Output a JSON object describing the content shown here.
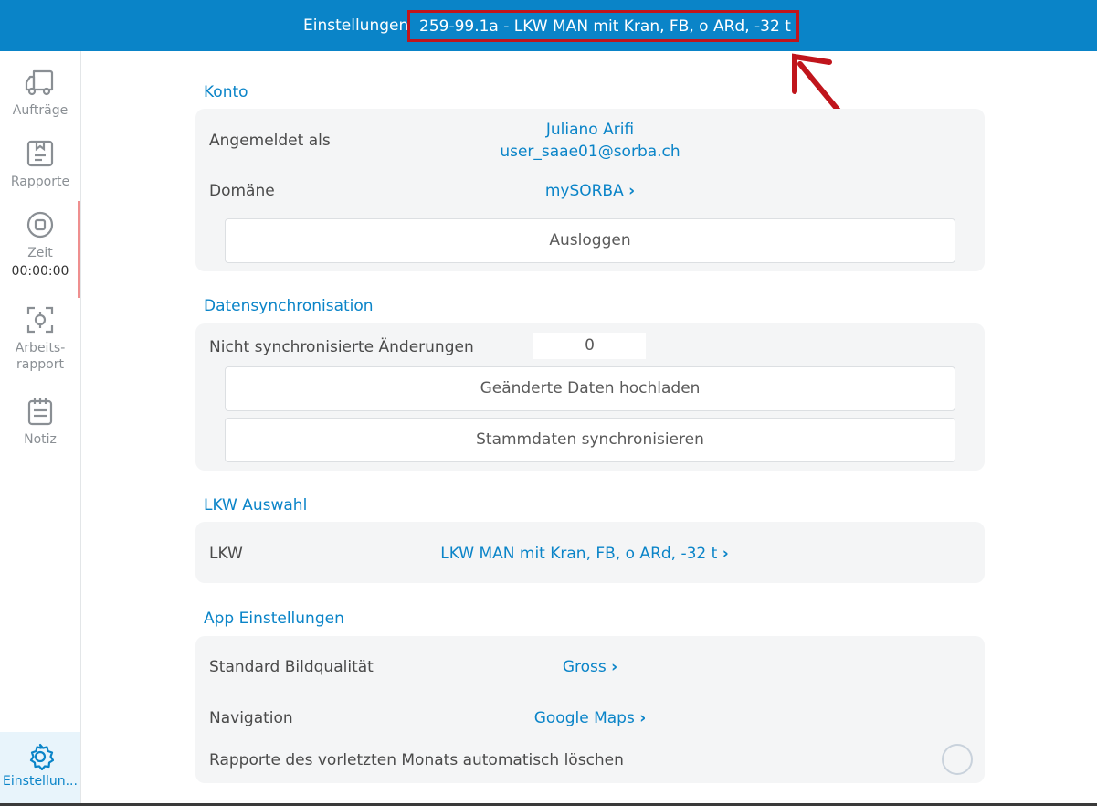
{
  "header": {
    "title": "Einstellungen",
    "vehicle": "259-99.1a - LKW MAN mit Kran, FB, o ARd, -32 t"
  },
  "sidebar": {
    "items": [
      {
        "label": "Aufträge",
        "icon": "truck-icon"
      },
      {
        "label": "Rapporte",
        "icon": "clipboard-icon"
      },
      {
        "label": "Zeit",
        "icon": "stop-circle-icon",
        "timer": "00:00:00"
      },
      {
        "label": "Arbeits-\nrapport",
        "icon": "scan-icon"
      },
      {
        "label": "Notiz",
        "icon": "notepad-icon"
      }
    ],
    "settings": {
      "label": "Einstellun...",
      "icon": "gear-icon"
    }
  },
  "konto": {
    "title": "Konto",
    "logged_in_label": "Angemeldet als",
    "user_name": "Juliano Arifi",
    "user_email": "user_saae01@sorba.ch",
    "domain_label": "Domäne",
    "domain_value": "mySORBA",
    "logout": "Ausloggen"
  },
  "sync": {
    "title": "Datensynchronisation",
    "unsynced_label": "Nicht synchronisierte Änderungen",
    "unsynced_count": "0",
    "upload": "Geänderte Daten hochladen",
    "master": "Stammdaten synchronisieren"
  },
  "lkw": {
    "title": "LKW Auswahl",
    "label": "LKW",
    "value": "LKW MAN mit Kran, FB, o ARd, -32 t"
  },
  "app": {
    "title": "App Einstellungen",
    "quality_label": "Standard Bildqualität",
    "quality_value": "Gross",
    "nav_label": "Navigation",
    "nav_value": "Google Maps",
    "autodelete_label": "Rapporte des vorletzten Monats automatisch löschen"
  },
  "chevron": "›",
  "colors": {
    "accent": "#0a84c8",
    "highlight": "#c0151c",
    "card": "#f4f5f6"
  }
}
